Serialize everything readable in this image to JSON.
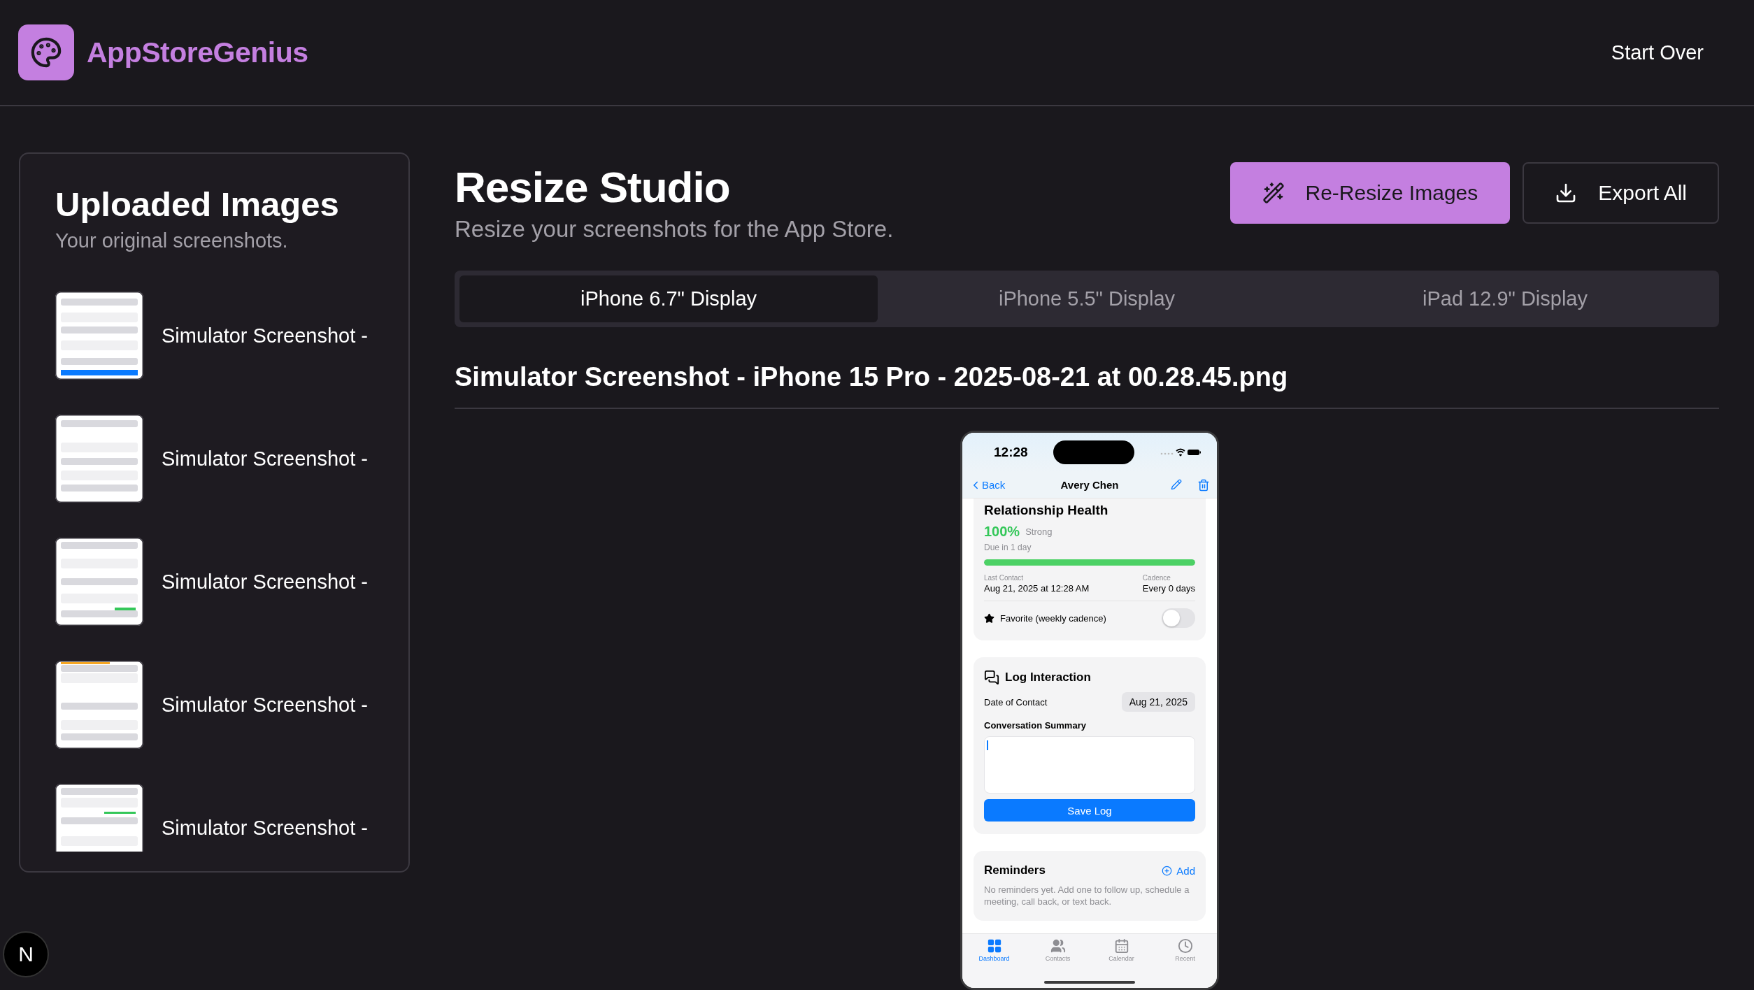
{
  "header": {
    "brand": "AppStoreGenius",
    "action": "Start Over"
  },
  "sidebar": {
    "title": "Uploaded Images",
    "subtitle": "Your original screenshots.",
    "items": [
      {
        "label": "Simulator Screenshot -"
      },
      {
        "label": "Simulator Screenshot -"
      },
      {
        "label": "Simulator Screenshot -"
      },
      {
        "label": "Simulator Screenshot -"
      },
      {
        "label": "Simulator Screenshot -"
      }
    ]
  },
  "main": {
    "title": "Resize Studio",
    "subtitle": "Resize your screenshots for the App Store.",
    "buttons": [
      {
        "kind": "primary",
        "label": "Re-Resize Images"
      },
      {
        "kind": "secondary",
        "label": "Export All"
      }
    ],
    "tabs": [
      {
        "label": "iPhone 6.7\" Display",
        "selected": true
      },
      {
        "label": "iPhone 5.5\" Display",
        "selected": false
      },
      {
        "label": "iPad 12.9\" Display",
        "selected": false
      }
    ],
    "file_name": "Simulator Screenshot - iPhone 15 Pro - 2025-08-21 at 00.28.45.png",
    "phone": {
      "time": "12:28",
      "back": "Back",
      "title": "Avery Chen",
      "health": {
        "title": "Relationship Health",
        "percent": "100%",
        "status": "Strong",
        "due": "Due in 1 day",
        "level": 1,
        "last_contact_label": "Last Contact",
        "last_contact": "Aug 21, 2025 at 12:28 AM",
        "cadence_label": "Cadence",
        "cadence": "Every 0 days",
        "favorite_label": "Favorite (weekly cadence)",
        "favorite_on": false
      },
      "log": {
        "title": "Log Interaction",
        "date_label": "Date of Contact",
        "date_value": "Aug 21, 2025",
        "summary_label": "Conversation Summary",
        "save": "Save Log"
      },
      "reminders": {
        "title": "Reminders",
        "add": "Add",
        "empty": "No reminders yet. Add one to follow up, schedule a meeting, call back, or text back."
      },
      "tabbar": [
        {
          "kind": "dashboard",
          "label": "Dashboard",
          "selected": true
        },
        {
          "kind": "contacts",
          "label": "Contacts",
          "selected": false
        },
        {
          "kind": "calendar",
          "label": "Calendar",
          "selected": false
        },
        {
          "kind": "recent",
          "label": "Recent",
          "selected": false
        }
      ]
    }
  },
  "dev_badge": "N"
}
